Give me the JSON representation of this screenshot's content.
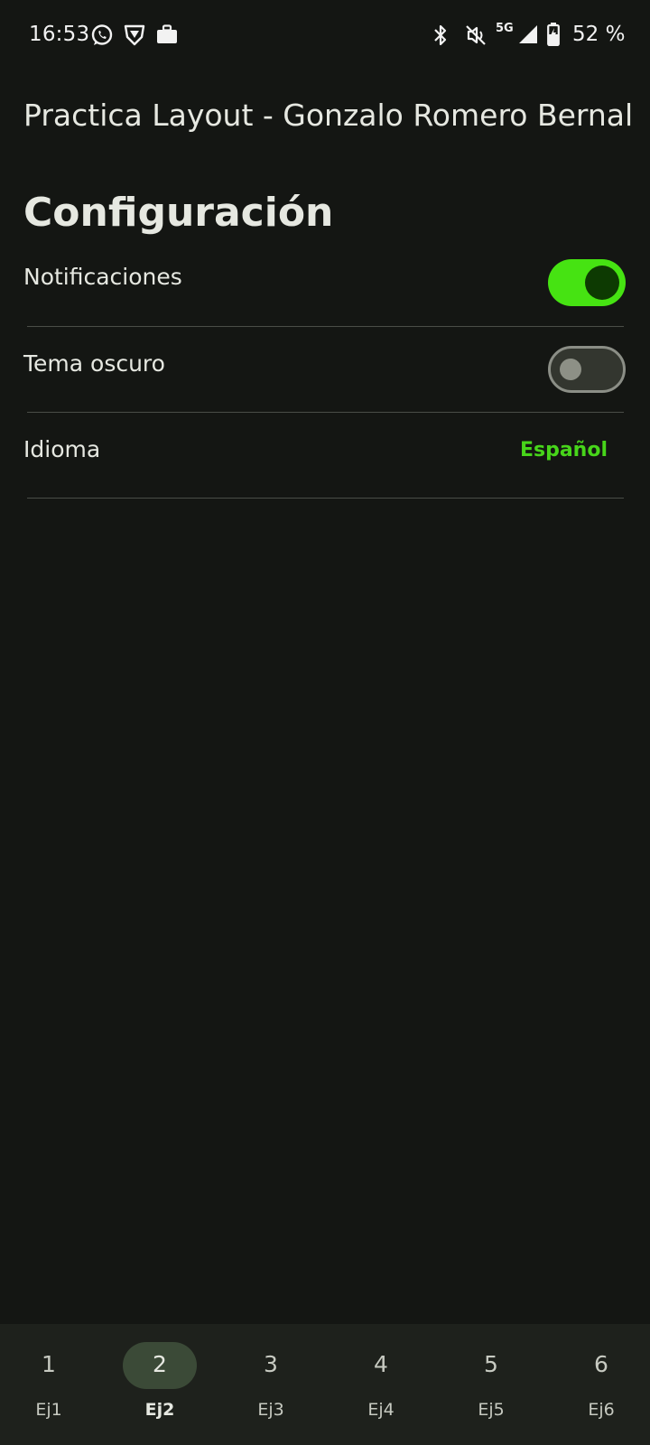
{
  "status_bar": {
    "time": "16:53",
    "left_icons": [
      "whatsapp-icon",
      "vpn-shield-icon",
      "briefcase-icon"
    ],
    "right_icons": [
      "bluetooth-icon",
      "vibrate-off-icon",
      "5g-signal-icon",
      "battery-charging-icon"
    ],
    "network": "5G",
    "battery": "52 %"
  },
  "app": {
    "title": "Practica Layout - Gonzalo Romero Bernal"
  },
  "settings": {
    "heading": "Configuración",
    "notifications": {
      "label": "Notificaciones",
      "enabled": true
    },
    "dark_theme": {
      "label": "Tema oscuro",
      "enabled": false
    },
    "language": {
      "label": "Idioma",
      "value": "Español"
    }
  },
  "bottom_nav": {
    "items": [
      {
        "icon_text": "1",
        "label": "Ej1",
        "active": false
      },
      {
        "icon_text": "2",
        "label": "Ej2",
        "active": true
      },
      {
        "icon_text": "3",
        "label": "Ej3",
        "active": false
      },
      {
        "icon_text": "4",
        "label": "Ej4",
        "active": false
      },
      {
        "icon_text": "5",
        "label": "Ej5",
        "active": false
      },
      {
        "icon_text": "6",
        "label": "Ej6",
        "active": false
      }
    ]
  },
  "colors": {
    "background": "#141613",
    "accent": "#46e312",
    "accent_text": "#47d51a",
    "nav_background": "#1e211c",
    "nav_active_pill": "#3b4a37"
  }
}
